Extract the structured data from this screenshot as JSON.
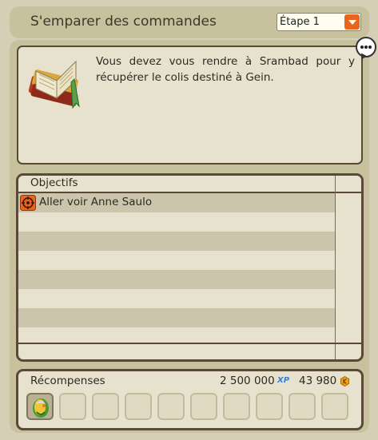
{
  "header": {
    "title": "S'emparer des commandes",
    "step_selected": "Étape 1"
  },
  "description": {
    "text": "Vous devez vous rendre à Srambad pour y récupérer le colis destiné à Gein.",
    "icon": "book-icon"
  },
  "objectives": {
    "header": "Objectifs",
    "items": [
      {
        "label": "Aller voir Anne Saulo",
        "icon": "target-icon"
      }
    ]
  },
  "rewards": {
    "label": "Récompenses",
    "xp": "2 500 000",
    "xp_icon_label": "XP",
    "kamas": "43 980",
    "items": [
      {
        "icon": "equipment-item-icon"
      }
    ]
  },
  "colors": {
    "background": "#d5d0b5",
    "panel": "#c7c19d",
    "box": "#e6e2cd",
    "border": "#5a4936",
    "accent": "#e9651d"
  }
}
